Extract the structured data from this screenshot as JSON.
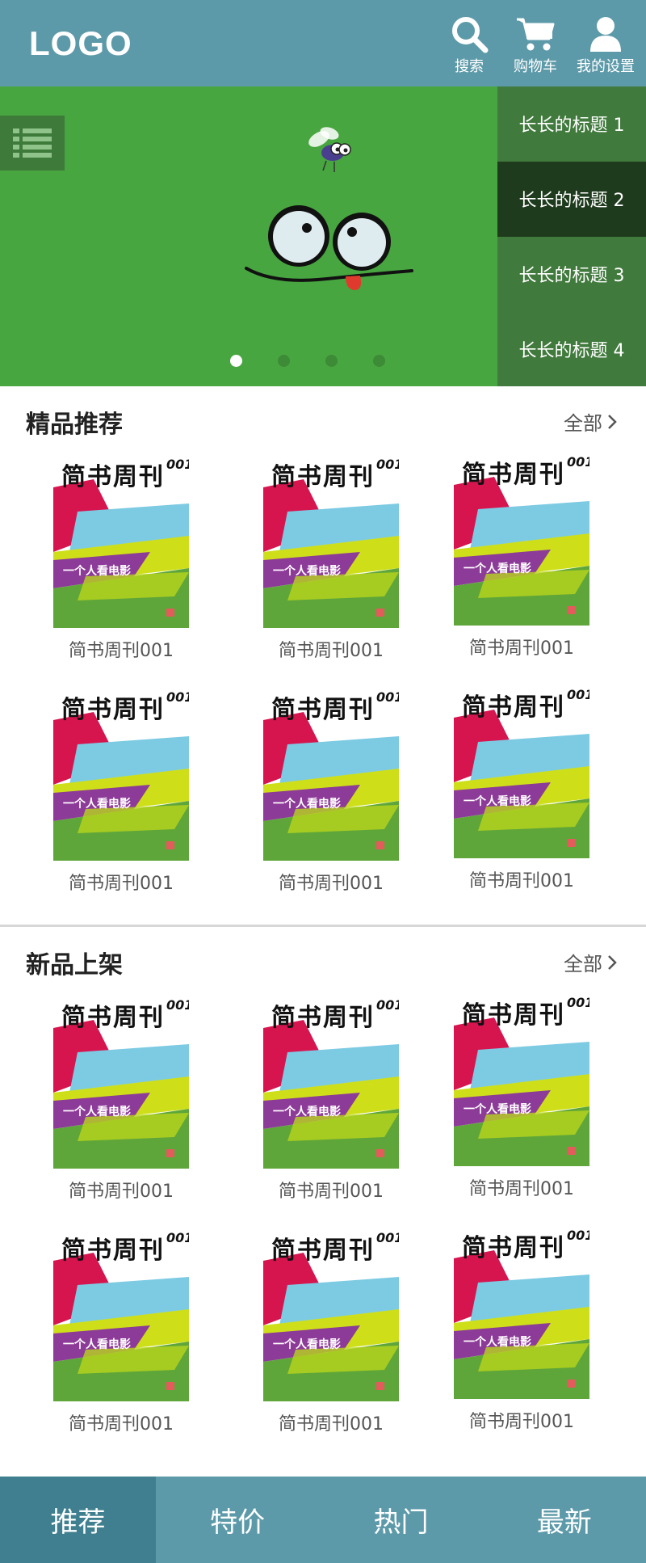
{
  "header": {
    "logo": "LOGO",
    "buttons": [
      {
        "label": "搜索",
        "icon": "search-icon"
      },
      {
        "label": "购物车",
        "icon": "cart-icon"
      },
      {
        "label": "我的设置",
        "icon": "user-icon"
      }
    ]
  },
  "banner": {
    "menu_icon": "list-icon",
    "titles": [
      "长长的标题 1",
      "长长的标题 2",
      "长长的标题 3",
      "长长的标题 4"
    ],
    "active_title_index": 1,
    "slide_count": 4,
    "active_slide_index": 0
  },
  "sections": [
    {
      "title": "精品推荐",
      "more_label": "全部",
      "items": [
        {
          "label": "简书周刊001",
          "cover_title": "简书周刊",
          "cover_issue": "001",
          "cover_sub": "一个人看电影"
        },
        {
          "label": "简书周刊001",
          "cover_title": "简书周刊",
          "cover_issue": "001",
          "cover_sub": "一个人看电影"
        },
        {
          "label": "简书周刊001",
          "cover_title": "简书周刊",
          "cover_issue": "001",
          "cover_sub": "一个人看电影"
        },
        {
          "label": "简书周刊001",
          "cover_title": "简书周刊",
          "cover_issue": "001",
          "cover_sub": "一个人看电影"
        },
        {
          "label": "简书周刊001",
          "cover_title": "简书周刊",
          "cover_issue": "001",
          "cover_sub": "一个人看电影"
        },
        {
          "label": "简书周刊001",
          "cover_title": "简书周刊",
          "cover_issue": "001",
          "cover_sub": "一个人看电影"
        }
      ]
    },
    {
      "title": "新品上架",
      "more_label": "全部",
      "items": [
        {
          "label": "简书周刊001",
          "cover_title": "简书周刊",
          "cover_issue": "001",
          "cover_sub": "一个人看电影"
        },
        {
          "label": "简书周刊001",
          "cover_title": "简书周刊",
          "cover_issue": "001",
          "cover_sub": "一个人看电影"
        },
        {
          "label": "简书周刊001",
          "cover_title": "简书周刊",
          "cover_issue": "001",
          "cover_sub": "一个人看电影"
        },
        {
          "label": "简书周刊001",
          "cover_title": "简书周刊",
          "cover_issue": "001",
          "cover_sub": "一个人看电影"
        },
        {
          "label": "简书周刊001",
          "cover_title": "简书周刊",
          "cover_issue": "001",
          "cover_sub": "一个人看电影"
        },
        {
          "label": "简书周刊001",
          "cover_title": "简书周刊",
          "cover_issue": "001",
          "cover_sub": "一个人看电影"
        }
      ]
    }
  ],
  "bottom_nav": {
    "tabs": [
      "推荐",
      "特价",
      "热门",
      "最新"
    ],
    "active_index": 0
  },
  "colors": {
    "header_bg": "#5d9aa9",
    "banner_bg": "#48a640",
    "banner_list_bg": "#417a3d",
    "banner_list_active": "#1f3b1d",
    "nav_active": "#3f7f8f"
  }
}
